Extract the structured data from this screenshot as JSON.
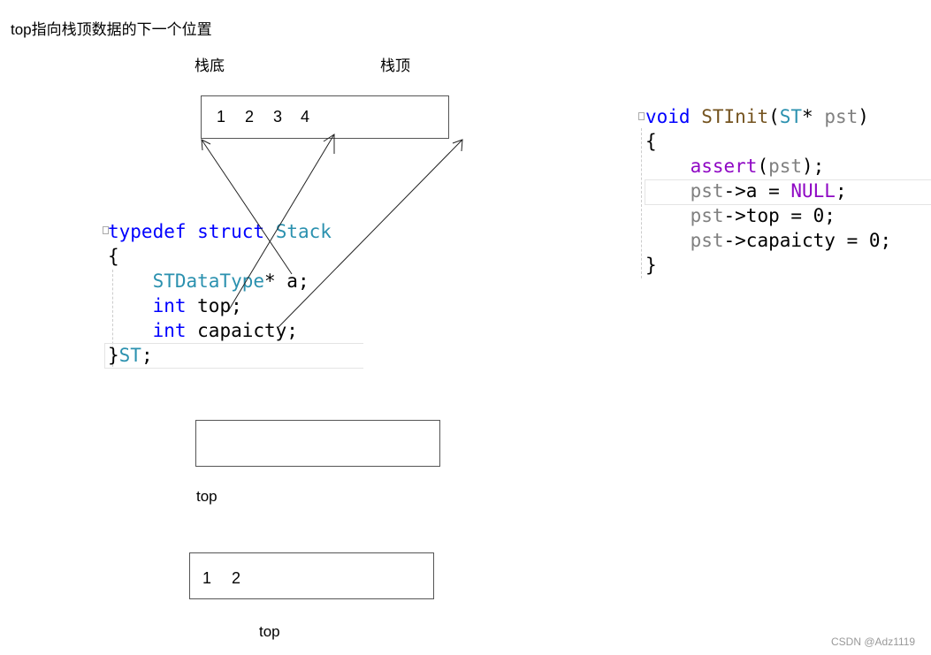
{
  "title": "top指向栈顶数据的下一个位置",
  "labels": {
    "bottom": "栈底",
    "top_label": "栈顶"
  },
  "stack_box_1": {
    "values": [
      "1",
      "2",
      "3",
      "4"
    ]
  },
  "stack_box_2": {
    "values": [],
    "pointer_label": "top"
  },
  "stack_box_3": {
    "values": [
      "1",
      "2"
    ],
    "pointer_label": "top"
  },
  "struct_code": [
    [
      {
        "t": "typedef",
        "c": "kw"
      },
      {
        "t": " ",
        "c": "pl"
      },
      {
        "t": "struct",
        "c": "kw"
      },
      {
        "t": " ",
        "c": "pl"
      },
      {
        "t": "Stack",
        "c": "ty"
      }
    ],
    [
      {
        "t": "{",
        "c": "pl"
      }
    ],
    [
      {
        "t": "    ",
        "c": "pl"
      },
      {
        "t": "STDataType",
        "c": "ty"
      },
      {
        "t": "* a;",
        "c": "pl"
      }
    ],
    [
      {
        "t": "    ",
        "c": "pl"
      },
      {
        "t": "int",
        "c": "kw"
      },
      {
        "t": " top;",
        "c": "pl"
      }
    ],
    [
      {
        "t": "    ",
        "c": "pl"
      },
      {
        "t": "int",
        "c": "kw"
      },
      {
        "t": " capaicty;",
        "c": "pl"
      }
    ],
    [
      {
        "t": "}",
        "c": "pl"
      },
      {
        "t": "ST",
        "c": "ty"
      },
      {
        "t": ";",
        "c": "pl"
      }
    ]
  ],
  "init_code": [
    [
      {
        "t": "void",
        "c": "kw"
      },
      {
        "t": " ",
        "c": "pl"
      },
      {
        "t": "STInit",
        "c": "fn"
      },
      {
        "t": "(",
        "c": "pl"
      },
      {
        "t": "ST",
        "c": "ty"
      },
      {
        "t": "* ",
        "c": "pl"
      },
      {
        "t": "pst",
        "c": "pa"
      },
      {
        "t": ")",
        "c": "pl"
      }
    ],
    [
      {
        "t": "{",
        "c": "pl"
      }
    ],
    [
      {
        "t": "    ",
        "c": "pl"
      },
      {
        "t": "assert",
        "c": "mac"
      },
      {
        "t": "(",
        "c": "pl"
      },
      {
        "t": "pst",
        "c": "pa"
      },
      {
        "t": ");",
        "c": "pl"
      }
    ],
    [
      {
        "t": "    ",
        "c": "pl"
      },
      {
        "t": "pst",
        "c": "pa"
      },
      {
        "t": "->a = ",
        "c": "pl"
      },
      {
        "t": "NULL",
        "c": "mac"
      },
      {
        "t": ";",
        "c": "pl"
      }
    ],
    [
      {
        "t": "    ",
        "c": "pl"
      },
      {
        "t": "pst",
        "c": "pa"
      },
      {
        "t": "->top = 0;",
        "c": "pl"
      }
    ],
    [
      {
        "t": "    ",
        "c": "pl"
      },
      {
        "t": "pst",
        "c": "pa"
      },
      {
        "t": "->capaicty = 0;",
        "c": "pl"
      }
    ],
    [
      {
        "t": "}",
        "c": "pl"
      }
    ]
  ],
  "colors": {
    "kw": "#0000ff",
    "ty": "#2b91af",
    "fn": "#74531f",
    "pa": "#808080",
    "mac": "#8f08c4",
    "pl": "#000000"
  },
  "watermark": "CSDN @Adz1119"
}
